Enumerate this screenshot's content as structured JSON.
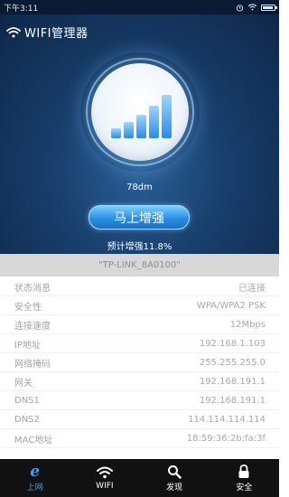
{
  "status_bar": {
    "time": "下午3:11"
  },
  "app": {
    "title": "WIFI管理器"
  },
  "signal": {
    "strength": "78dm"
  },
  "boost": {
    "button_label": "马上增强",
    "estimate": "预计增强11.8%"
  },
  "network": {
    "ssid": "\"TP-LINK_8A0100\""
  },
  "info_rows": [
    {
      "label": "状态消息",
      "value": "已连接"
    },
    {
      "label": "安全性",
      "value": "WPA/WPA2 PSK"
    },
    {
      "label": "连接速度",
      "value": "12Mbps"
    },
    {
      "label": "IP地址",
      "value": "192.168.1.103"
    },
    {
      "label": "网络掩码",
      "value": "255.255.255.0"
    },
    {
      "label": "网关",
      "value": "192.168.191.1"
    },
    {
      "label": "DNS1",
      "value": "192.168.191.1"
    },
    {
      "label": "DNS2",
      "value": "114.114.114.114"
    },
    {
      "label": "MAC地址",
      "value": "18:59:36:2b:fa:3f"
    }
  ],
  "tabs": [
    {
      "label": "上网",
      "icon": "e-browser-icon",
      "active": true
    },
    {
      "label": "WIFI",
      "icon": "wifi-icon",
      "active": false
    },
    {
      "label": "发现",
      "icon": "search-icon",
      "active": false
    },
    {
      "label": "安全",
      "icon": "lock-icon",
      "active": false
    }
  ],
  "colors": {
    "accent": "#3fa2f0",
    "hero_dark": "#0e2749",
    "tabbar": "#111111"
  }
}
